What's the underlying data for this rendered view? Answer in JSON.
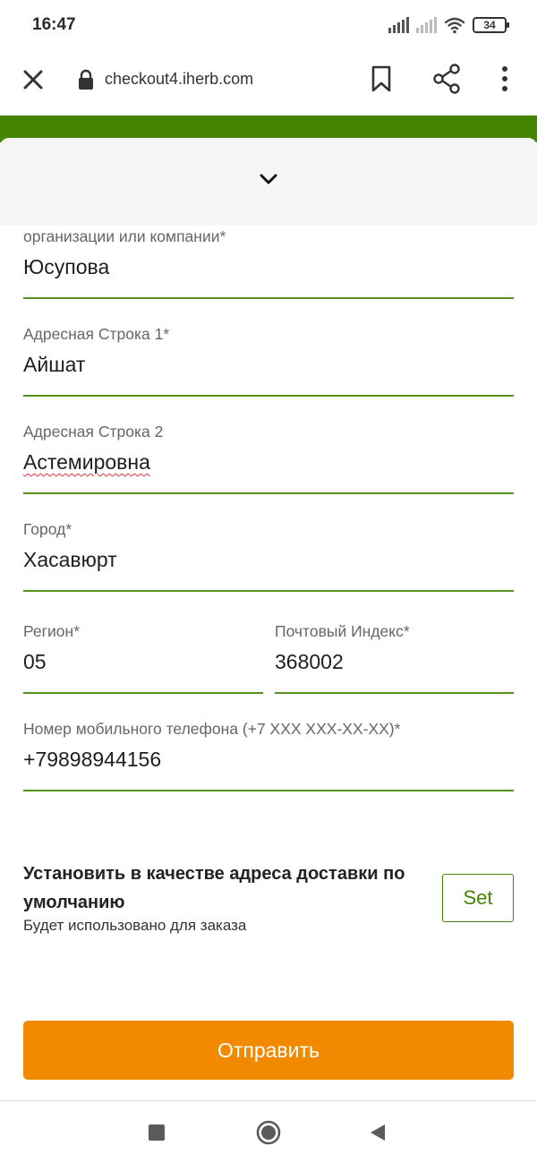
{
  "status_bar": {
    "time": "16:47",
    "battery": "34",
    "icons": [
      "signal-icon",
      "signal-icon-dim",
      "wifi-icon",
      "battery-icon"
    ]
  },
  "browser": {
    "url": "checkout4.iherb.com",
    "icons": [
      "close-icon",
      "lock-icon",
      "bookmark-icon",
      "share-icon",
      "more-vert-icon"
    ]
  },
  "sheet": {
    "collapse_icon": "chevron-down-icon",
    "fields": {
      "company": {
        "label": "организации или компании*",
        "value": "Юсупова"
      },
      "address1": {
        "label": "Адресная Строка 1*",
        "value": "Айшат"
      },
      "address2": {
        "label": "Адресная Строка 2",
        "value": "Астемировна"
      },
      "city": {
        "label": "Город*",
        "value": "Хасавюрт"
      },
      "region": {
        "label": "Регион*",
        "value": "05"
      },
      "postal": {
        "label": "Почтовый Индекс*",
        "value": "368002"
      },
      "phone": {
        "label": "Номер мобильного телефона (+7 XXX XXX-XX-XX)*",
        "value": "+79898944156"
      }
    },
    "default_address": {
      "title": "Установить в качестве адреса доставки по умолчанию",
      "subtitle": "Будет использовано для заказа",
      "button_label": "Set"
    },
    "submit_label": "Отправить"
  },
  "colors": {
    "brand_green": "#458500",
    "field_underline": "#5a8f1e",
    "submit_orange": "#f18a00"
  },
  "nav_bar": {
    "icons": [
      "recents-icon",
      "home-icon",
      "back-icon"
    ]
  }
}
